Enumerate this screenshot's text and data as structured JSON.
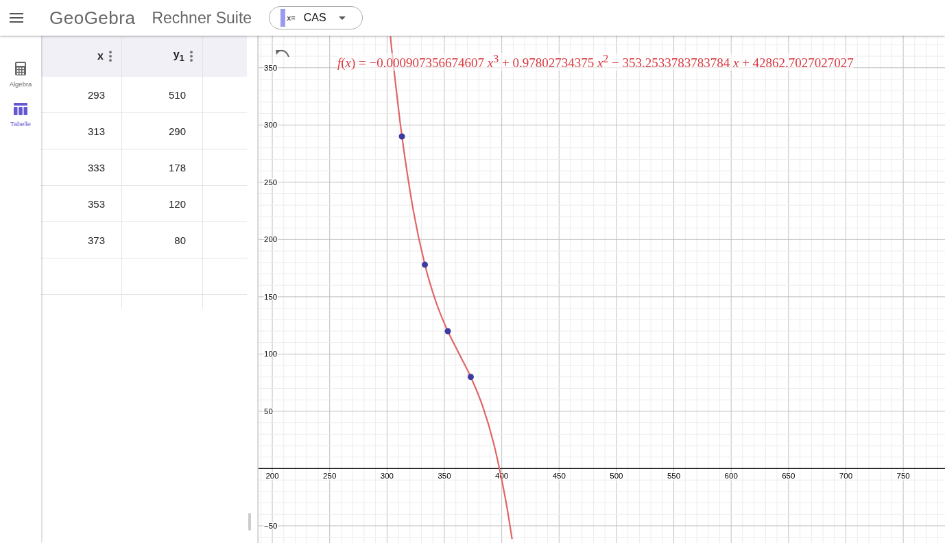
{
  "header": {
    "logo": "GeoGebra",
    "title": "Rechner Suite",
    "app_switcher": {
      "label": "CAS",
      "icon_text": "x="
    }
  },
  "sidebar": {
    "items": [
      {
        "label": "Algebra",
        "kind": "calculator",
        "selected": false
      },
      {
        "label": "Tabelle",
        "kind": "table",
        "selected": true
      }
    ]
  },
  "table": {
    "columns": [
      {
        "label": "x"
      },
      {
        "label": "y$_{1}$"
      }
    ],
    "rows": [
      [
        "293",
        "510"
      ],
      [
        "313",
        "290"
      ],
      [
        "333",
        "178"
      ],
      [
        "353",
        "120"
      ],
      [
        "373",
        "80"
      ]
    ]
  },
  "graphics": {
    "formula": "*f*(*x*) = −0.000907356674607 *x*$^{3}$ + 0.97802734375 *x*$^{2}$ − 353.2533783783784 *x* + 42862.7027027027",
    "chart_data": {
      "type": "scatter",
      "grid": true,
      "x": [
        313,
        333,
        353,
        373
      ],
      "series": [
        {
          "type": "line",
          "color": "#e06666",
          "x": [
            303,
            305,
            313,
            323,
            333,
            343,
            353,
            363,
            373,
            383,
            393,
            403,
            409
          ],
          "values": [
            377.5,
            358,
            290,
            225,
            178,
            144.5,
            120,
            100,
            80,
            55.5,
            22,
            -25,
            -61.6
          ]
        },
        {
          "type": "scatter",
          "color": "#3f3aa0",
          "values": [
            290,
            178,
            120,
            80
          ]
        }
      ],
      "xlim": [
        188,
        787
      ],
      "ylim": [
        -65,
        378
      ],
      "xticks": [
        200,
        250,
        300,
        350,
        400,
        450,
        500,
        550,
        600,
        650,
        700,
        750
      ],
      "yticks": [
        {
          "value": -50,
          "label": "−50"
        },
        50,
        100,
        150,
        200,
        250,
        300,
        350
      ]
    }
  }
}
